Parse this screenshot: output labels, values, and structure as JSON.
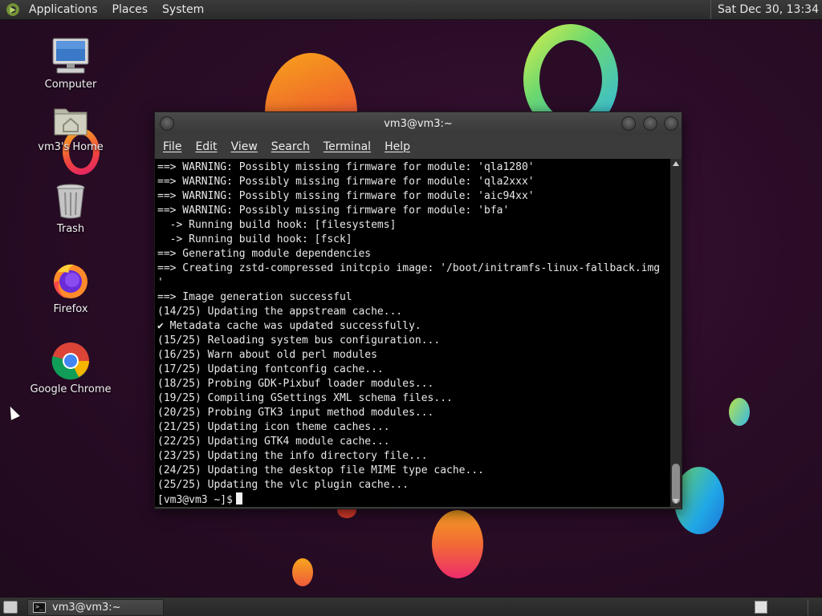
{
  "top_panel": {
    "menus": [
      "Applications",
      "Places",
      "System"
    ],
    "clock": "Sat Dec 30, 13:34"
  },
  "desktop_icons": [
    {
      "label": "Computer",
      "icon": "computer-icon"
    },
    {
      "label": "vm3's Home",
      "icon": "home-folder-icon"
    },
    {
      "label": "Trash",
      "icon": "trash-icon"
    },
    {
      "label": "Firefox",
      "icon": "firefox-icon"
    },
    {
      "label": "Google Chrome",
      "icon": "chrome-icon"
    }
  ],
  "terminal_window": {
    "title": "vm3@vm3:~",
    "menu": [
      "File",
      "Edit",
      "View",
      "Search",
      "Terminal",
      "Help"
    ],
    "lines": [
      "==> WARNING: Possibly missing firmware for module: 'qla1280'",
      "==> WARNING: Possibly missing firmware for module: 'qla2xxx'",
      "==> WARNING: Possibly missing firmware for module: 'aic94xx'",
      "==> WARNING: Possibly missing firmware for module: 'bfa'",
      "  -> Running build hook: [filesystems]",
      "  -> Running build hook: [fsck]",
      "==> Generating module dependencies",
      "==> Creating zstd-compressed initcpio image: '/boot/initramfs-linux-fallback.img",
      "'",
      "==> Image generation successful",
      "(14/25) Updating the appstream cache...",
      "✔ Metadata cache was updated successfully.",
      "(15/25) Reloading system bus configuration...",
      "(16/25) Warn about old perl modules",
      "(17/25) Updating fontconfig cache...",
      "(18/25) Probing GDK-Pixbuf loader modules...",
      "(19/25) Compiling GSettings XML schema files...",
      "(20/25) Probing GTK3 input method modules...",
      "(21/25) Updating icon theme caches...",
      "(22/25) Updating GTK4 module cache...",
      "(23/25) Updating the info directory file...",
      "(24/25) Updating the desktop file MIME type cache...",
      "(25/25) Updating the vlc plugin cache..."
    ],
    "prompt": "[vm3@vm3 ~]$"
  },
  "bottom_panel": {
    "task_label": "vm3@vm3:~",
    "task_icon_text": ">_"
  }
}
